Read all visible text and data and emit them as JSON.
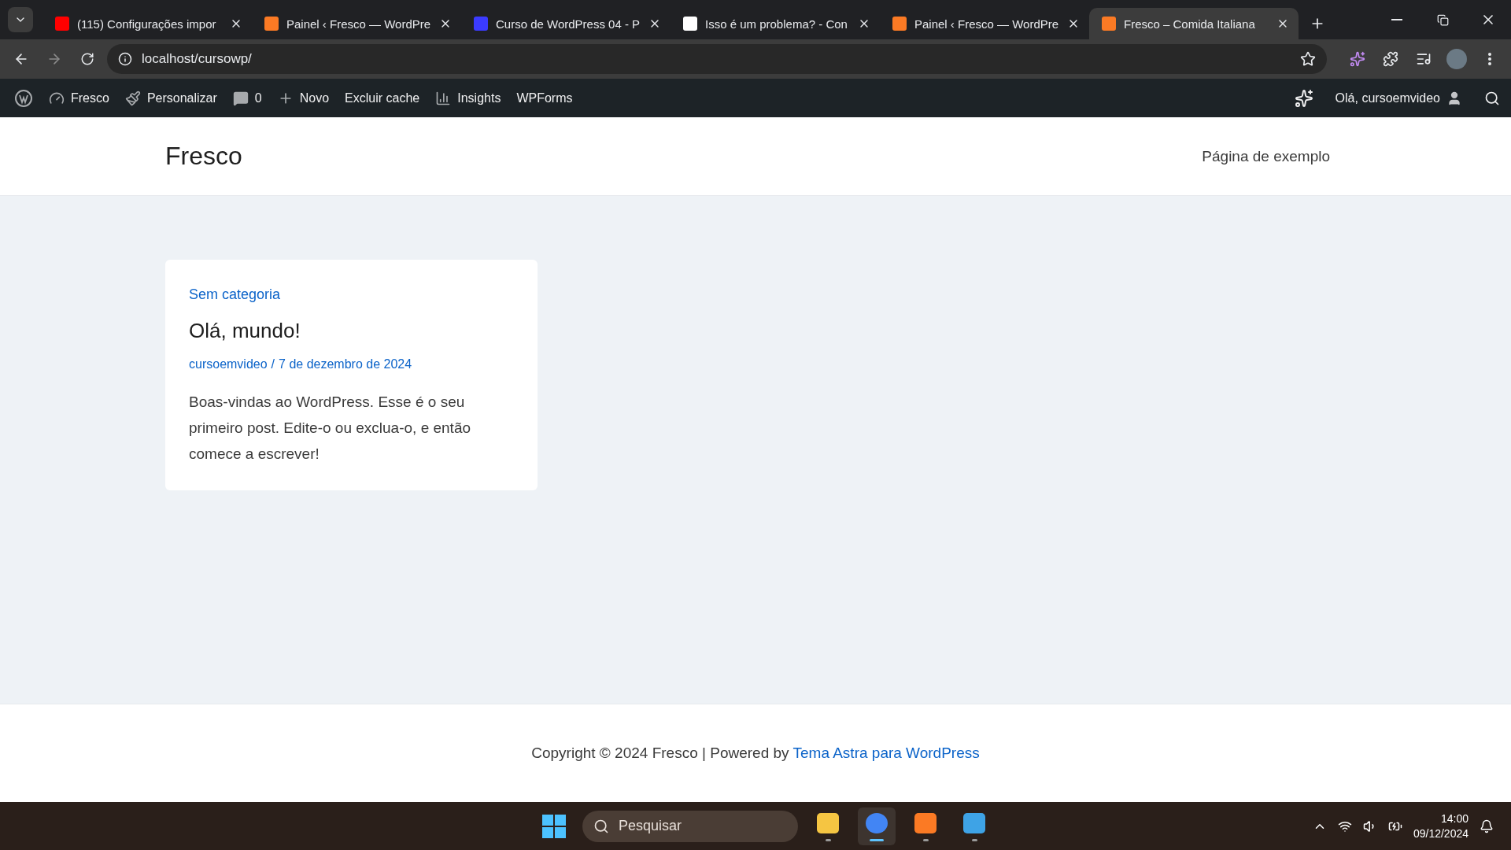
{
  "browser": {
    "tabs": [
      {
        "kind": "youtube",
        "title": "(115) Configurações impor",
        "selected": false
      },
      {
        "kind": "xampp",
        "title": "Painel ‹ Fresco — WordPre",
        "selected": false
      },
      {
        "kind": "video",
        "title": "Curso de WordPress 04 - P",
        "selected": false
      },
      {
        "kind": "cloud",
        "title": "Isso é um problema? - Con",
        "selected": false
      },
      {
        "kind": "xampp",
        "title": "Painel ‹ Fresco — WordPre",
        "selected": false
      },
      {
        "kind": "xampp",
        "title": "Fresco – Comida Italiana",
        "selected": true
      }
    ],
    "url": "localhost/cursowp/"
  },
  "admin_bar": {
    "items": [
      {
        "kind": "wp"
      },
      {
        "kind": "site",
        "label": "Fresco"
      },
      {
        "kind": "customize",
        "label": "Personalizar"
      },
      {
        "kind": "comments",
        "label": "0"
      },
      {
        "kind": "new",
        "label": "Novo"
      },
      {
        "kind": "text",
        "label": "Excluir cache"
      },
      {
        "kind": "insights",
        "label": "Insights"
      },
      {
        "kind": "text",
        "label": "WPForms"
      }
    ],
    "greeting": "Olá, cursoemvideo"
  },
  "site": {
    "title": "Fresco",
    "nav": [
      "Página de exemplo"
    ]
  },
  "post": {
    "category": "Sem categoria",
    "title": "Olá, mundo!",
    "author": "cursoemvideo",
    "separator": "/",
    "date": "7 de dezembro de 2024",
    "excerpt": "Boas-vindas ao WordPress. Esse é o seu primeiro post. Edite-o ou exclua-o, e então comece a escrever!"
  },
  "footer": {
    "text": "Copyright © 2024 Fresco | Powered by ",
    "link": "Tema Astra para WordPress"
  },
  "taskbar": {
    "search_placeholder": "Pesquisar",
    "apps": [
      {
        "kind": "files",
        "selected": false
      },
      {
        "kind": "chrome",
        "selected": true
      },
      {
        "kind": "xampp",
        "selected": false
      },
      {
        "kind": "photos",
        "selected": false
      }
    ],
    "time": "14:00",
    "date": "09/12/2024"
  }
}
